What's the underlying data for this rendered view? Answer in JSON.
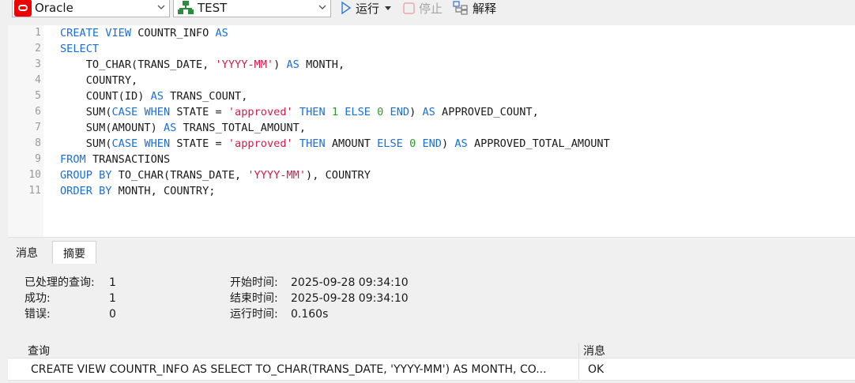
{
  "toolbar": {
    "connection": "Oracle",
    "database": "TEST",
    "run_label": "运行",
    "stop_label": "停止",
    "explain_label": "解释",
    "run_icon": "play-icon",
    "stop_icon": "stop-icon",
    "explain_icon": "explain-icon",
    "db_icon": "database-tree-icon"
  },
  "editor": {
    "line_numbers": [
      "1",
      "2",
      "3",
      "4",
      "5",
      "6",
      "7",
      "8",
      "9",
      "10",
      "11"
    ]
  },
  "tabs": {
    "messages": "消息",
    "summary": "摘要"
  },
  "summary": {
    "processed_label": "已处理的查询:",
    "processed_value": "1",
    "success_label": "成功:",
    "success_value": "1",
    "error_label": "错误:",
    "error_value": "0",
    "start_label": "开始时间:",
    "start_value": "2025-09-28 09:34:10",
    "end_label": "结束时间:",
    "end_value": "2025-09-28 09:34:10",
    "elapsed_label": "运行时间:",
    "elapsed_value": "0.160s"
  },
  "grid": {
    "col_query": "查询",
    "col_message": "消息",
    "row_query": "CREATE VIEW COUNTR_INFO AS SELECT TO_CHAR(TRANS_DATE, 'YYYY-MM') AS MONTH, CO...",
    "row_message": "OK"
  },
  "colors": {
    "keyword": "#1a6fd6",
    "string": "#d61a4a",
    "number": "#2b9a2b",
    "oracle_brand": "#ee0000"
  }
}
